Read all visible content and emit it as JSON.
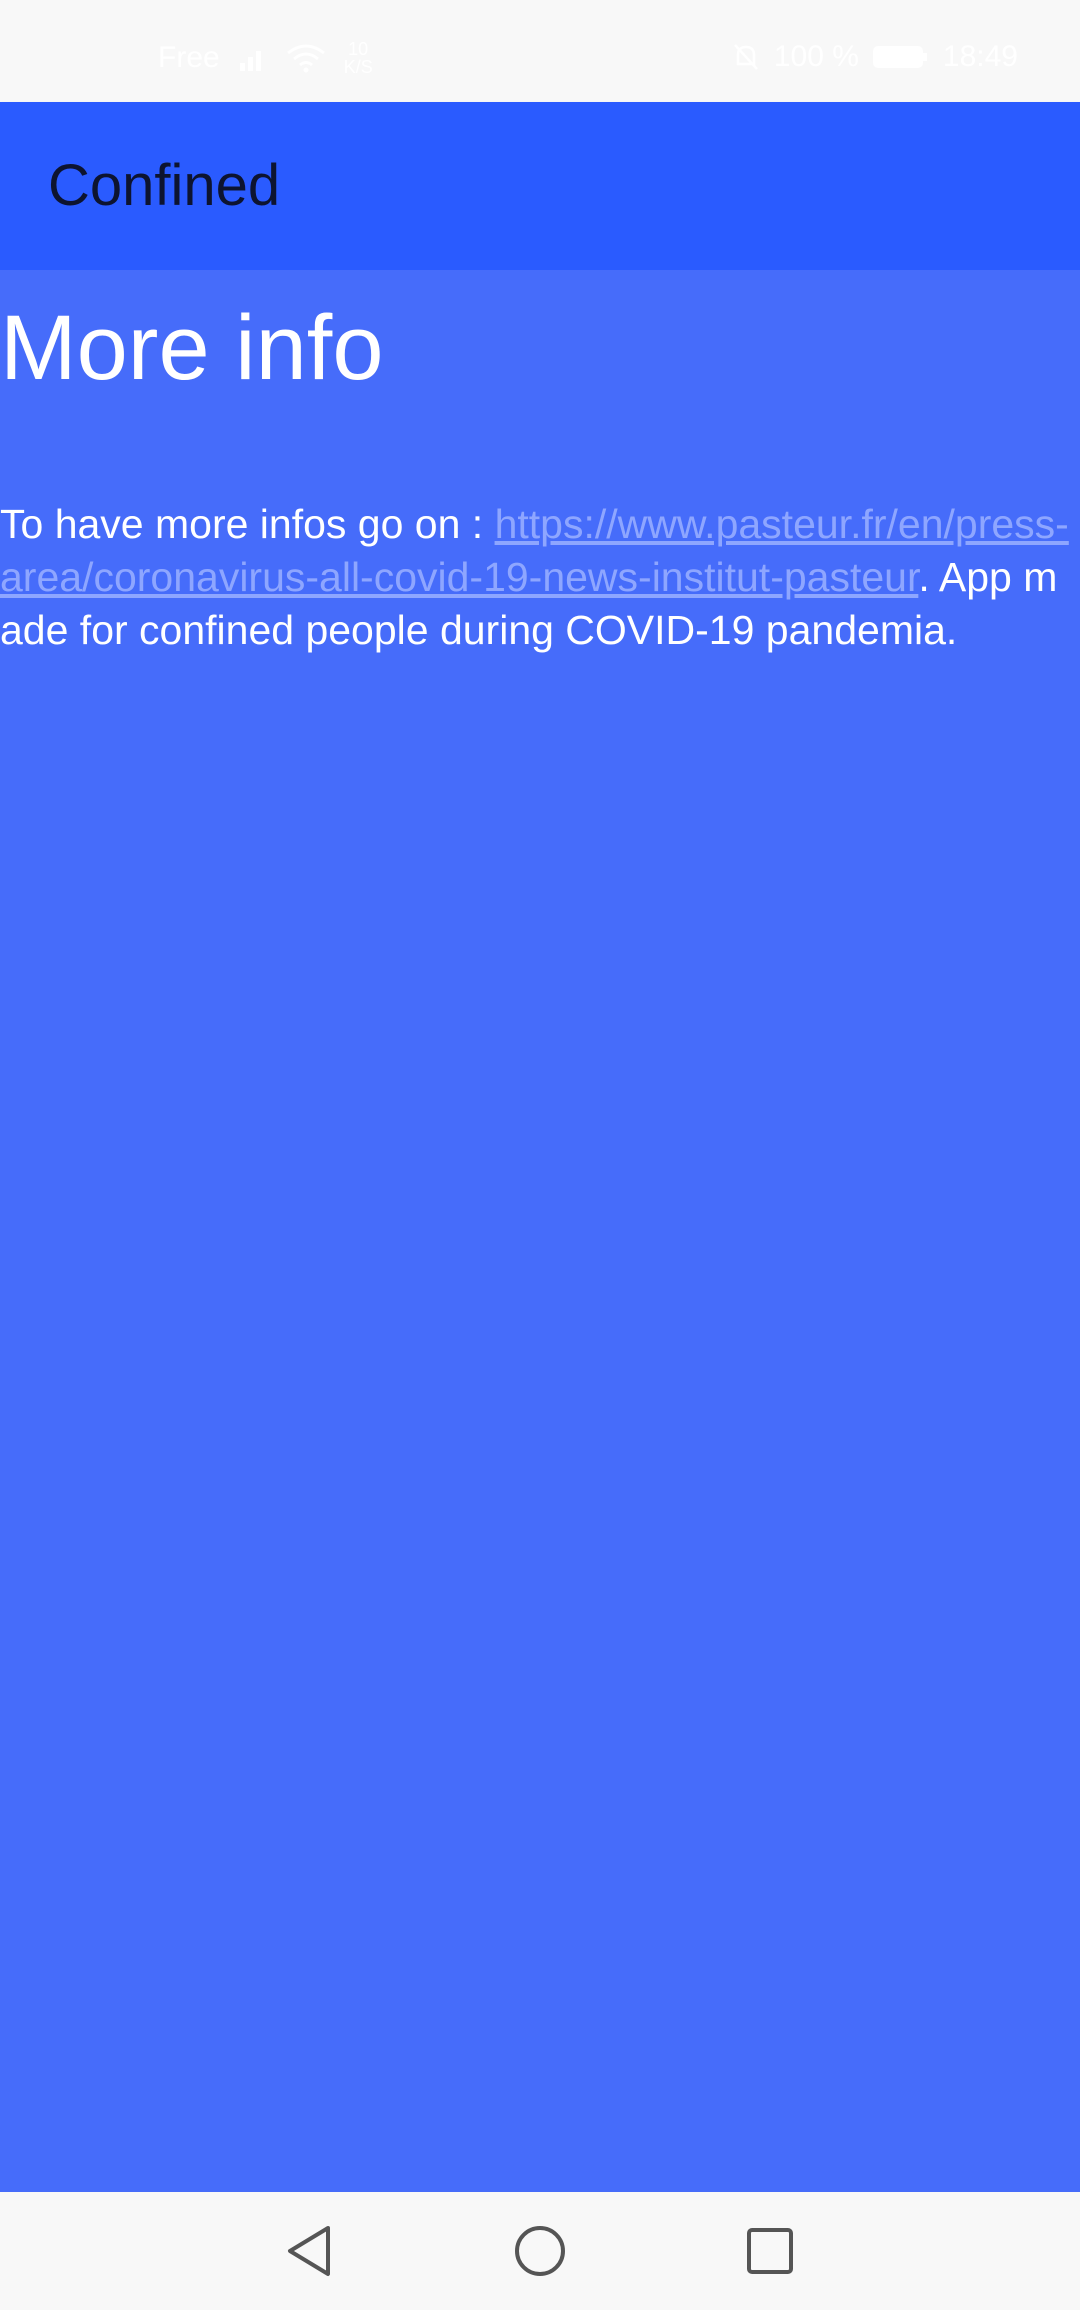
{
  "status_bar": {
    "carrier": "Free",
    "signal": "4G",
    "wifi_rate_top": "10",
    "wifi_rate_bottom": "K/S",
    "battery_percent": "100 %",
    "time": "18:49",
    "icons": [
      "signal-icon",
      "wifi-icon",
      "alarm-off-icon",
      "battery-icon"
    ]
  },
  "app_bar": {
    "title": "Confined",
    "color": "#2a5bff"
  },
  "main": {
    "heading": "More info",
    "text_before": "To have more infos go on : ",
    "link_text": "https://www.pasteur.fr/en/press-area/coronavirus-all-covid-19-news-institut-pasteur",
    "text_after": ". App made for confined people during COVID-19 pandemia.",
    "background": "#466cfa",
    "link_color": "#8ea6ff"
  },
  "nav_bar": {
    "icons": [
      "back-icon",
      "home-icon",
      "recent-apps-icon"
    ]
  }
}
